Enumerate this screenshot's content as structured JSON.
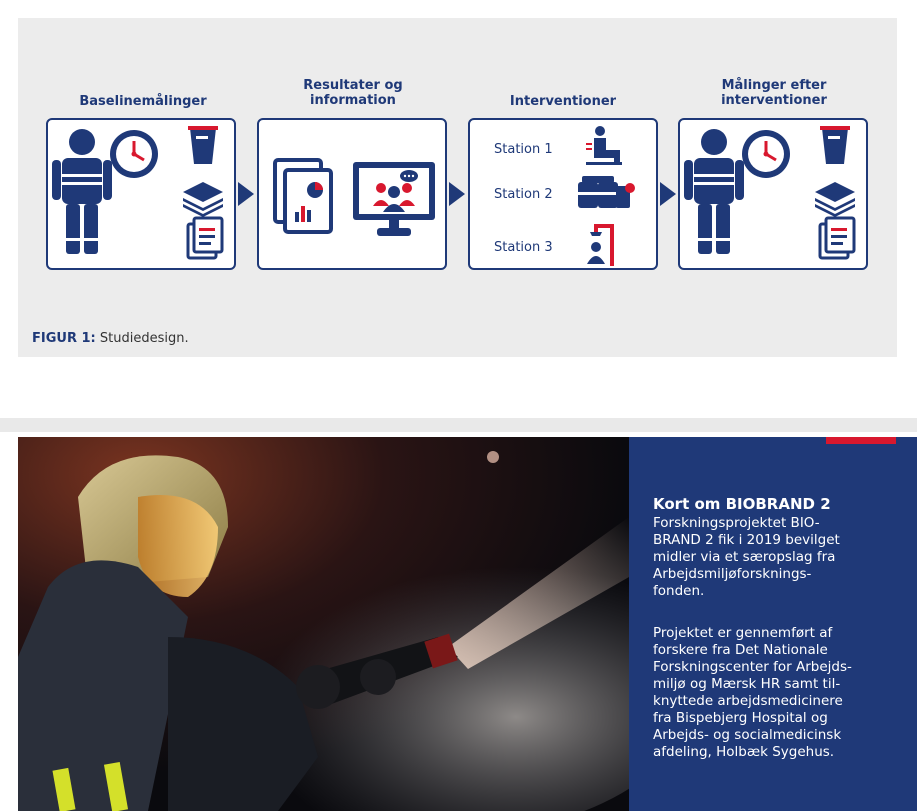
{
  "figure": {
    "stages": [
      {
        "title": "Baselinemålinger"
      },
      {
        "title": "Resultater og\ninformation"
      },
      {
        "title": "Interventioner"
      },
      {
        "title": "Målinger efter\ninterventioner"
      }
    ],
    "stations": [
      "Station 1",
      "Station 2",
      "Station 3"
    ],
    "caption_label": "FIGUR 1:",
    "caption_text": " Studiedesign.",
    "colors": {
      "navy": "#1f3978",
      "red": "#d8182e",
      "panel": "#ececec"
    }
  },
  "sidebar": {
    "title": "Kort om BIOBRAND 2",
    "paragraph1": "Forskningsprojektet BIO-\nBRAND 2 fik i 2019 bevilget\nmidler via et særopslag fra\nArbejdsmiljøforsknings-\nfonden.",
    "paragraph2": "Projektet er gennemført af\nforskere fra Det Nationale\nForskningscenter for Arbejds-\nmiljø og Mærsk HR samt til-\nknyttede arbejdsmedicinere\nfra Bispebjerg Hospital og\nArbejds- og socialmedicinsk\nafdeling, Holbæk Sygehus."
  }
}
